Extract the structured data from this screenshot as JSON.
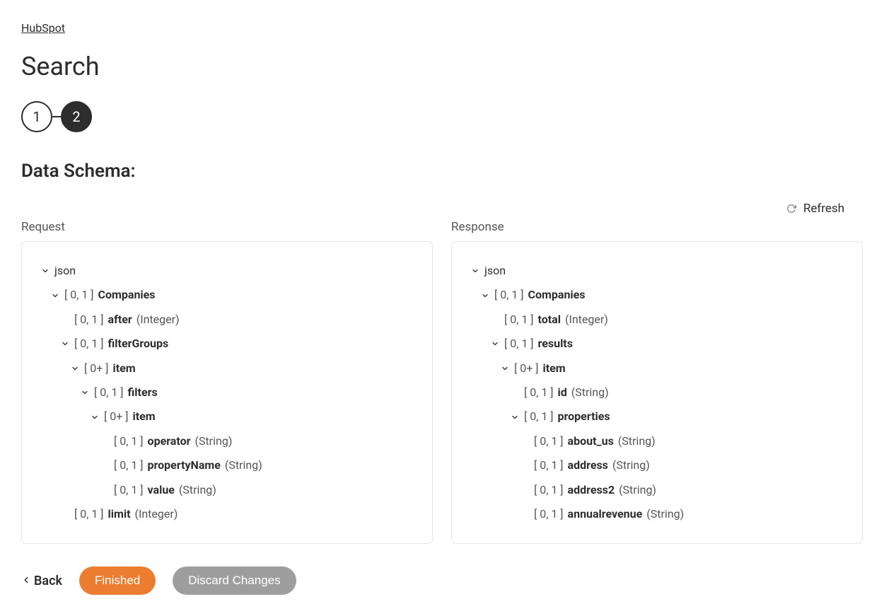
{
  "breadcrumb": {
    "root": "HubSpot"
  },
  "page": {
    "title": "Search"
  },
  "stepper": {
    "step1": "1",
    "step2": "2",
    "active": 2
  },
  "section": {
    "title": "Data Schema:"
  },
  "refresh": "Refresh",
  "request": {
    "title": "Request",
    "tree": [
      {
        "depth": 0,
        "chevron": true,
        "card": "",
        "name": "json",
        "type": "",
        "bold": false
      },
      {
        "depth": 1,
        "chevron": true,
        "card": "[ 0, 1 ]",
        "name": "Companies",
        "type": "",
        "bold": true
      },
      {
        "depth": 2,
        "chevron": false,
        "card": "[ 0, 1 ]",
        "name": "after",
        "type": "(Integer)",
        "bold": true
      },
      {
        "depth": 2,
        "chevron": true,
        "card": "[ 0, 1 ]",
        "name": "filterGroups",
        "type": "",
        "bold": true
      },
      {
        "depth": 3,
        "chevron": true,
        "card": "[ 0+ ]",
        "name": "item",
        "type": "",
        "bold": true
      },
      {
        "depth": 4,
        "chevron": true,
        "card": "[ 0, 1 ]",
        "name": "filters",
        "type": "",
        "bold": true
      },
      {
        "depth": 5,
        "chevron": true,
        "card": "[ 0+ ]",
        "name": "item",
        "type": "",
        "bold": true
      },
      {
        "depth": 6,
        "chevron": false,
        "card": "[ 0, 1 ]",
        "name": "operator",
        "type": "(String)",
        "bold": true
      },
      {
        "depth": 6,
        "chevron": false,
        "card": "[ 0, 1 ]",
        "name": "propertyName",
        "type": "(String)",
        "bold": true
      },
      {
        "depth": 6,
        "chevron": false,
        "card": "[ 0, 1 ]",
        "name": "value",
        "type": "(String)",
        "bold": true
      },
      {
        "depth": 2,
        "chevron": false,
        "card": "[ 0, 1 ]",
        "name": "limit",
        "type": "(Integer)",
        "bold": true
      }
    ]
  },
  "response": {
    "title": "Response",
    "tree": [
      {
        "depth": 0,
        "chevron": true,
        "card": "",
        "name": "json",
        "type": "",
        "bold": false
      },
      {
        "depth": 1,
        "chevron": true,
        "card": "[ 0, 1 ]",
        "name": "Companies",
        "type": "",
        "bold": true
      },
      {
        "depth": 2,
        "chevron": false,
        "card": "[ 0, 1 ]",
        "name": "total",
        "type": "(Integer)",
        "bold": true
      },
      {
        "depth": 2,
        "chevron": true,
        "card": "[ 0, 1 ]",
        "name": "results",
        "type": "",
        "bold": true
      },
      {
        "depth": 3,
        "chevron": true,
        "card": "[ 0+ ]",
        "name": "item",
        "type": "",
        "bold": true
      },
      {
        "depth": 4,
        "chevron": false,
        "card": "[ 0, 1 ]",
        "name": "id",
        "type": "(String)",
        "bold": true
      },
      {
        "depth": 4,
        "chevron": true,
        "card": "[ 0, 1 ]",
        "name": "properties",
        "type": "",
        "bold": true
      },
      {
        "depth": 5,
        "chevron": false,
        "card": "[ 0, 1 ]",
        "name": "about_us",
        "type": "(String)",
        "bold": true
      },
      {
        "depth": 5,
        "chevron": false,
        "card": "[ 0, 1 ]",
        "name": "address",
        "type": "(String)",
        "bold": true
      },
      {
        "depth": 5,
        "chevron": false,
        "card": "[ 0, 1 ]",
        "name": "address2",
        "type": "(String)",
        "bold": true
      },
      {
        "depth": 5,
        "chevron": false,
        "card": "[ 0, 1 ]",
        "name": "annualrevenue",
        "type": "(String)",
        "bold": true
      }
    ]
  },
  "actions": {
    "back": "Back",
    "finished": "Finished",
    "discard": "Discard Changes"
  }
}
